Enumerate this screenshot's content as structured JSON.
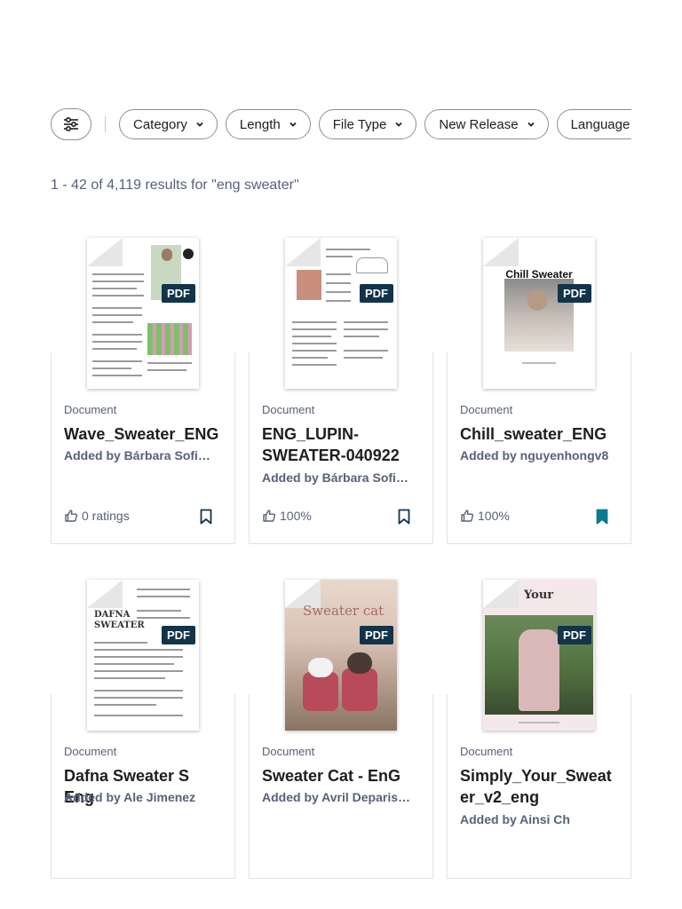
{
  "filters": {
    "filter_icon": "sliders-icon",
    "chips": [
      {
        "label": "Category"
      },
      {
        "label": "Length"
      },
      {
        "label": "File Type"
      },
      {
        "label": "New Release"
      },
      {
        "label": "Language"
      }
    ]
  },
  "results": {
    "summary": "1 - 42 of 4,119 results for \"eng sweater\""
  },
  "documents": [
    {
      "type": "Document",
      "title": "Wave_Sweater_ENG",
      "author": "Added by Bárbara Sofia…",
      "rating": "0 ratings",
      "badge": "PDF",
      "saved": false
    },
    {
      "type": "Document",
      "title": "ENG_LUPIN-SWEATER-040922",
      "author": "Added by Bárbara Sofia…",
      "rating": "100%",
      "badge": "PDF",
      "saved": false
    },
    {
      "type": "Document",
      "title": "Chill_sweater_ENG",
      "author": "Added by nguyenhongv8",
      "rating": "100%",
      "badge": "PDF",
      "saved": true,
      "thumb_text": "Chill Sweater"
    },
    {
      "type": "Document",
      "title": "Dafna Sweater S Eng",
      "author": "Added by Ale Jimenez",
      "badge": "PDF",
      "thumb_text": "DAFNA SWEATER"
    },
    {
      "type": "Document",
      "title": "Sweater Cat - EnG",
      "author": "Added by Avril Deparis…",
      "badge": "PDF",
      "thumb_text": "Sweater cat"
    },
    {
      "type": "Document",
      "title": "Simply_Your_Sweater_v2_eng",
      "author": "Added by Ainsi Ch",
      "badge": "PDF",
      "thumb_text": "Your"
    }
  ],
  "colors": {
    "accent": "#0a7a8c",
    "badge": "#12334a",
    "muted_text": "#57617a"
  }
}
